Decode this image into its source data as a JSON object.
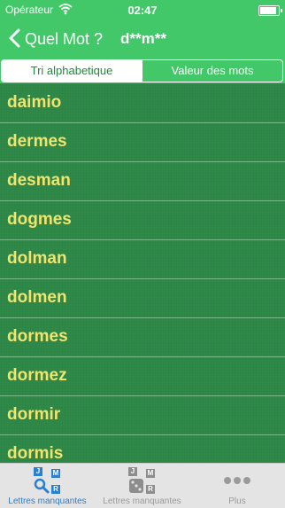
{
  "status": {
    "carrier": "Opérateur",
    "time": "02:47"
  },
  "nav": {
    "title": "Quel Mot ?",
    "pattern": "d**m**"
  },
  "segments": [
    "Tri alphabetique",
    "Valeur des mots"
  ],
  "words": [
    "daimio",
    "dermes",
    "desman",
    "dogmes",
    "dolman",
    "dolmen",
    "dormes",
    "dormez",
    "dormir",
    "dormis"
  ],
  "tabs": [
    {
      "label": "Lettres manquantes",
      "tiles": [
        "J",
        "M",
        "R"
      ]
    },
    {
      "label": "Lettres manquantes",
      "tiles": [
        "J",
        "M",
        "R"
      ]
    },
    {
      "label": "Plus"
    }
  ],
  "colors": {
    "bar_green": "#42c868",
    "felt_green": "#2f8a49",
    "word_yellow": "#f3e36c",
    "tab_active_blue": "#2b7fd0"
  }
}
